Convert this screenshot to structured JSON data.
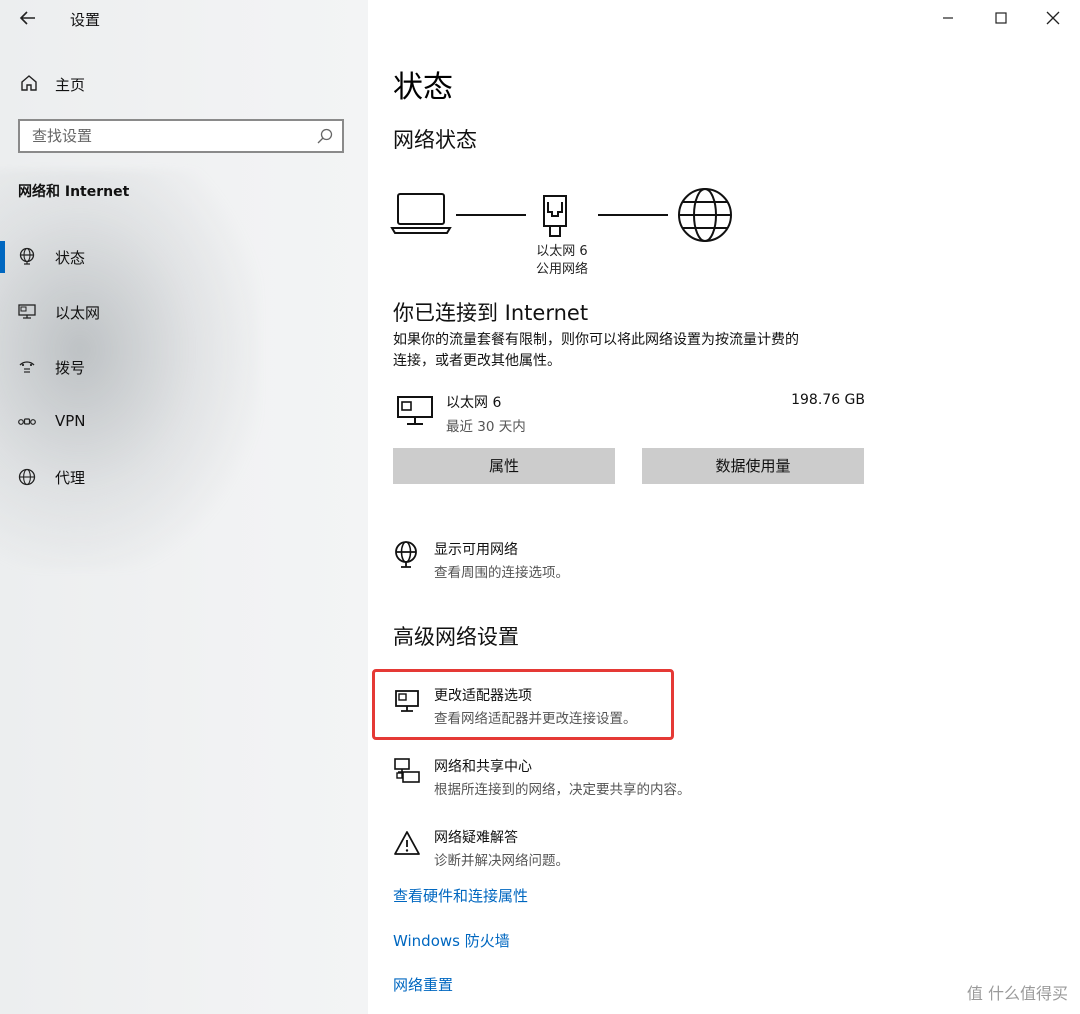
{
  "app": {
    "title": "设置",
    "back_icon": "back-arrow-icon"
  },
  "sidebar": {
    "home_label": "主页",
    "search_placeholder": "查找设置",
    "section_title": "网络和 Internet",
    "items": [
      {
        "label": "状态",
        "icon": "status-globe-icon",
        "active": true
      },
      {
        "label": "以太网",
        "icon": "ethernet-icon",
        "active": false
      },
      {
        "label": "拨号",
        "icon": "dialup-icon",
        "active": false
      },
      {
        "label": "VPN",
        "icon": "vpn-icon",
        "active": false
      },
      {
        "label": "代理",
        "icon": "proxy-globe-icon",
        "active": false
      }
    ]
  },
  "window_controls": {
    "minimize": "–",
    "maximize": "☐",
    "close": "✕"
  },
  "main": {
    "title": "状态",
    "network_status_heading": "网络状态",
    "diagram": {
      "adapter_name": "以太网 6",
      "network_type": "公用网络"
    },
    "connected_heading": "你已连接到 Internet",
    "connected_desc_line1": "如果你的流量套餐有限制，则你可以将此网络设置为按流量计费的",
    "connected_desc_line2": "连接，或者更改其他属性。",
    "adapter": {
      "name": "以太网 6",
      "period": "最近 30 天内",
      "usage": "198.76 GB"
    },
    "buttons": {
      "properties": "属性",
      "data_usage": "数据使用量"
    },
    "show_networks": {
      "title": "显示可用网络",
      "subtitle": "查看周围的连接选项。"
    },
    "advanced_heading": "高级网络设置",
    "advanced_items": [
      {
        "title": "更改适配器选项",
        "subtitle": "查看网络适配器并更改连接设置。"
      },
      {
        "title": "网络和共享中心",
        "subtitle": "根据所连接到的网络，决定要共享的内容。"
      },
      {
        "title": "网络疑难解答",
        "subtitle": "诊断并解决网络问题。"
      }
    ],
    "links": [
      "查看硬件和连接属性",
      "Windows 防火墙",
      "网络重置"
    ]
  },
  "watermark": "值 什么值得买",
  "colors": {
    "accent": "#0067c0",
    "highlight": "#e53935",
    "button_bg": "#cccccc"
  }
}
